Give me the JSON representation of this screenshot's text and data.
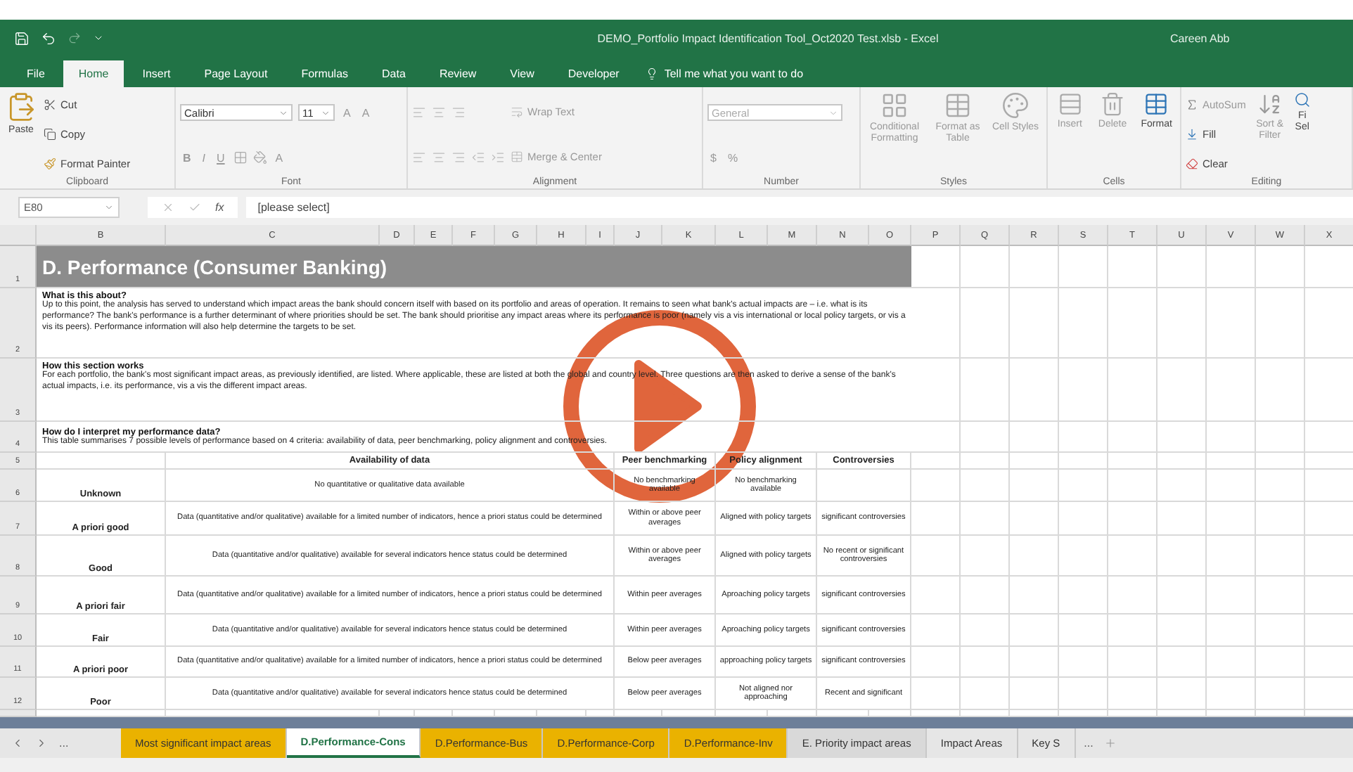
{
  "window": {
    "title": "DEMO_Portfolio Impact Identification Tool_Oct2020 Test.xlsb - Excel",
    "user": "Careen Abb"
  },
  "ribbon_tabs": [
    {
      "label": "File",
      "selected": false
    },
    {
      "label": "Home",
      "selected": true
    },
    {
      "label": "Insert",
      "selected": false
    },
    {
      "label": "Page Layout",
      "selected": false
    },
    {
      "label": "Formulas",
      "selected": false
    },
    {
      "label": "Data",
      "selected": false
    },
    {
      "label": "Review",
      "selected": false
    },
    {
      "label": "View",
      "selected": false
    },
    {
      "label": "Developer",
      "selected": false
    }
  ],
  "tell_me": "Tell me what you want to do",
  "ribbon": {
    "clipboard": {
      "label": "Clipboard",
      "paste": "Paste",
      "cut": "Cut",
      "copy": "Copy",
      "format_painter": "Format Painter"
    },
    "font": {
      "label": "Font",
      "font_name": "Calibri",
      "font_size": "11",
      "grow": "A",
      "shrink": "A",
      "bold": "B",
      "italic": "I",
      "underline": "U",
      "font_color": "A"
    },
    "alignment": {
      "label": "Alignment",
      "wrap_text": "Wrap Text",
      "merge_center": "Merge & Center"
    },
    "number": {
      "label": "Number",
      "format": "General",
      "currency": "$",
      "percent": "%"
    },
    "styles": {
      "label": "Styles",
      "conditional_formatting": "Conditional Formatting",
      "format_as_table": "Format as Table",
      "cell_styles": "Cell Styles"
    },
    "cells": {
      "label": "Cells",
      "insert": "Insert",
      "delete": "Delete",
      "format": "Format"
    },
    "editing": {
      "label": "Editing",
      "autosum": "AutoSum",
      "fill": "Fill",
      "clear": "Clear",
      "sort_filter": "Sort & Filter",
      "find_select": "Fi Sel"
    }
  },
  "formula_bar": {
    "name_box": "E80",
    "fx": "fx",
    "formula": "[please select]"
  },
  "columns": [
    "B",
    "C",
    "D",
    "E",
    "F",
    "G",
    "H",
    "I",
    "J",
    "K",
    "L",
    "M",
    "N",
    "O",
    "P",
    "Q",
    "R",
    "S",
    "T",
    "U",
    "V",
    "W",
    "X"
  ],
  "row_numbers": [
    "1",
    "2",
    "3",
    "4",
    "5",
    "6",
    "7",
    "8",
    "9",
    "10",
    "11",
    "12"
  ],
  "sheet_title": "D. Performance (Consumer Banking)",
  "sections": [
    {
      "heading": "What is this about?",
      "text": "Up to this point, the analysis has served to understand which impact areas the bank should concern itself with based on its portfolio and areas of operation. It remains to seen what bank's actual impacts are – i.e. what is its performance? The bank's performance is a further determinant of  where priorities should be set. The bank should prioritise any impact areas where its performance is poor (namely vis a vis international or local policy targets, or vis a vis its peers). Performance information will also help determine the targets to be set."
    },
    {
      "heading": "How this section works",
      "text": "For each portfolio, the bank's most significant impact areas, as previously identified, are listed. Where applicable, these are listed at both the global and country level. Three questions are then asked to derive a sense of the bank's actual impacts, i.e. its performance, vis a vis the different impact areas."
    },
    {
      "heading": "How do I interpret my performance data?",
      "text": "This table summarises 7 possible levels of performance based on 4 criteria: availability of data, peer benchmarking, policy alignment and controversies."
    }
  ],
  "table": {
    "headers": [
      "Availability of data",
      "Peer benchmarking",
      "Policy alignment",
      "Controversies"
    ],
    "rows": [
      {
        "level": "Unknown",
        "availability": "No quantitative or qualitative data available",
        "peer": "No benchmarking available",
        "policy": "No benchmarking available",
        "controversies": ""
      },
      {
        "level": "A priori good",
        "availability": "Data (quantitative and/or qualitative) available for a limited number of indicators, hence a priori status could be determined",
        "peer": "Within or above peer averages",
        "policy": "Aligned with policy targets",
        "controversies": "significant controversies"
      },
      {
        "level": "Good",
        "availability": "Data (quantitative and/or qualitative) available for several indicators hence status could be determined",
        "peer": "Within or above peer averages",
        "policy": "Aligned with policy targets",
        "controversies": "No recent or significant controversies"
      },
      {
        "level": "A priori fair",
        "availability": "Data (quantitative and/or qualitative) available for a limited number of indicators, hence a priori status could be determined",
        "peer": "Within peer averages",
        "policy": "Aproaching policy targets",
        "controversies": "significant controversies"
      },
      {
        "level": "Fair",
        "availability": "Data (quantitative and/or qualitative) available for several indicators hence status could be determined",
        "peer": "Within peer averages",
        "policy": "Aproaching policy targets",
        "controversies": "significant controversies"
      },
      {
        "level": "A priori poor",
        "availability": "Data (quantitative and/or qualitative) available for a limited number of indicators, hence a priori status could be determined",
        "peer": "Below peer averages",
        "policy": "approaching policy targets",
        "controversies": "significant controversies"
      },
      {
        "level": "Poor",
        "availability": "Data (quantitative and/or qualitative) available for several indicators hence status could be determined",
        "peer": "Below peer averages",
        "policy": "Not aligned nor approaching",
        "controversies": "Recent and significant"
      }
    ]
  },
  "sheet_tabs": {
    "more": "...",
    "tabs": [
      {
        "label": "Most significant impact areas",
        "color": "#eab200",
        "selected": false
      },
      {
        "label": "D.Performance-Cons",
        "selected": true
      },
      {
        "label": "D.Performance-Bus",
        "color": "#eab200",
        "selected": false
      },
      {
        "label": "D.Performance-Corp",
        "color": "#eab200",
        "selected": false
      },
      {
        "label": "D.Performance-Inv",
        "color": "#eab200",
        "selected": false
      },
      {
        "label": "E. Priority impact areas",
        "color": "#d9d9d9",
        "selected": false
      },
      {
        "label": "Impact Areas",
        "color": "#e6e6e6",
        "selected": false
      },
      {
        "label": "Key S",
        "color": "#e6e6e6",
        "selected": false
      }
    ],
    "overflow": "..."
  }
}
